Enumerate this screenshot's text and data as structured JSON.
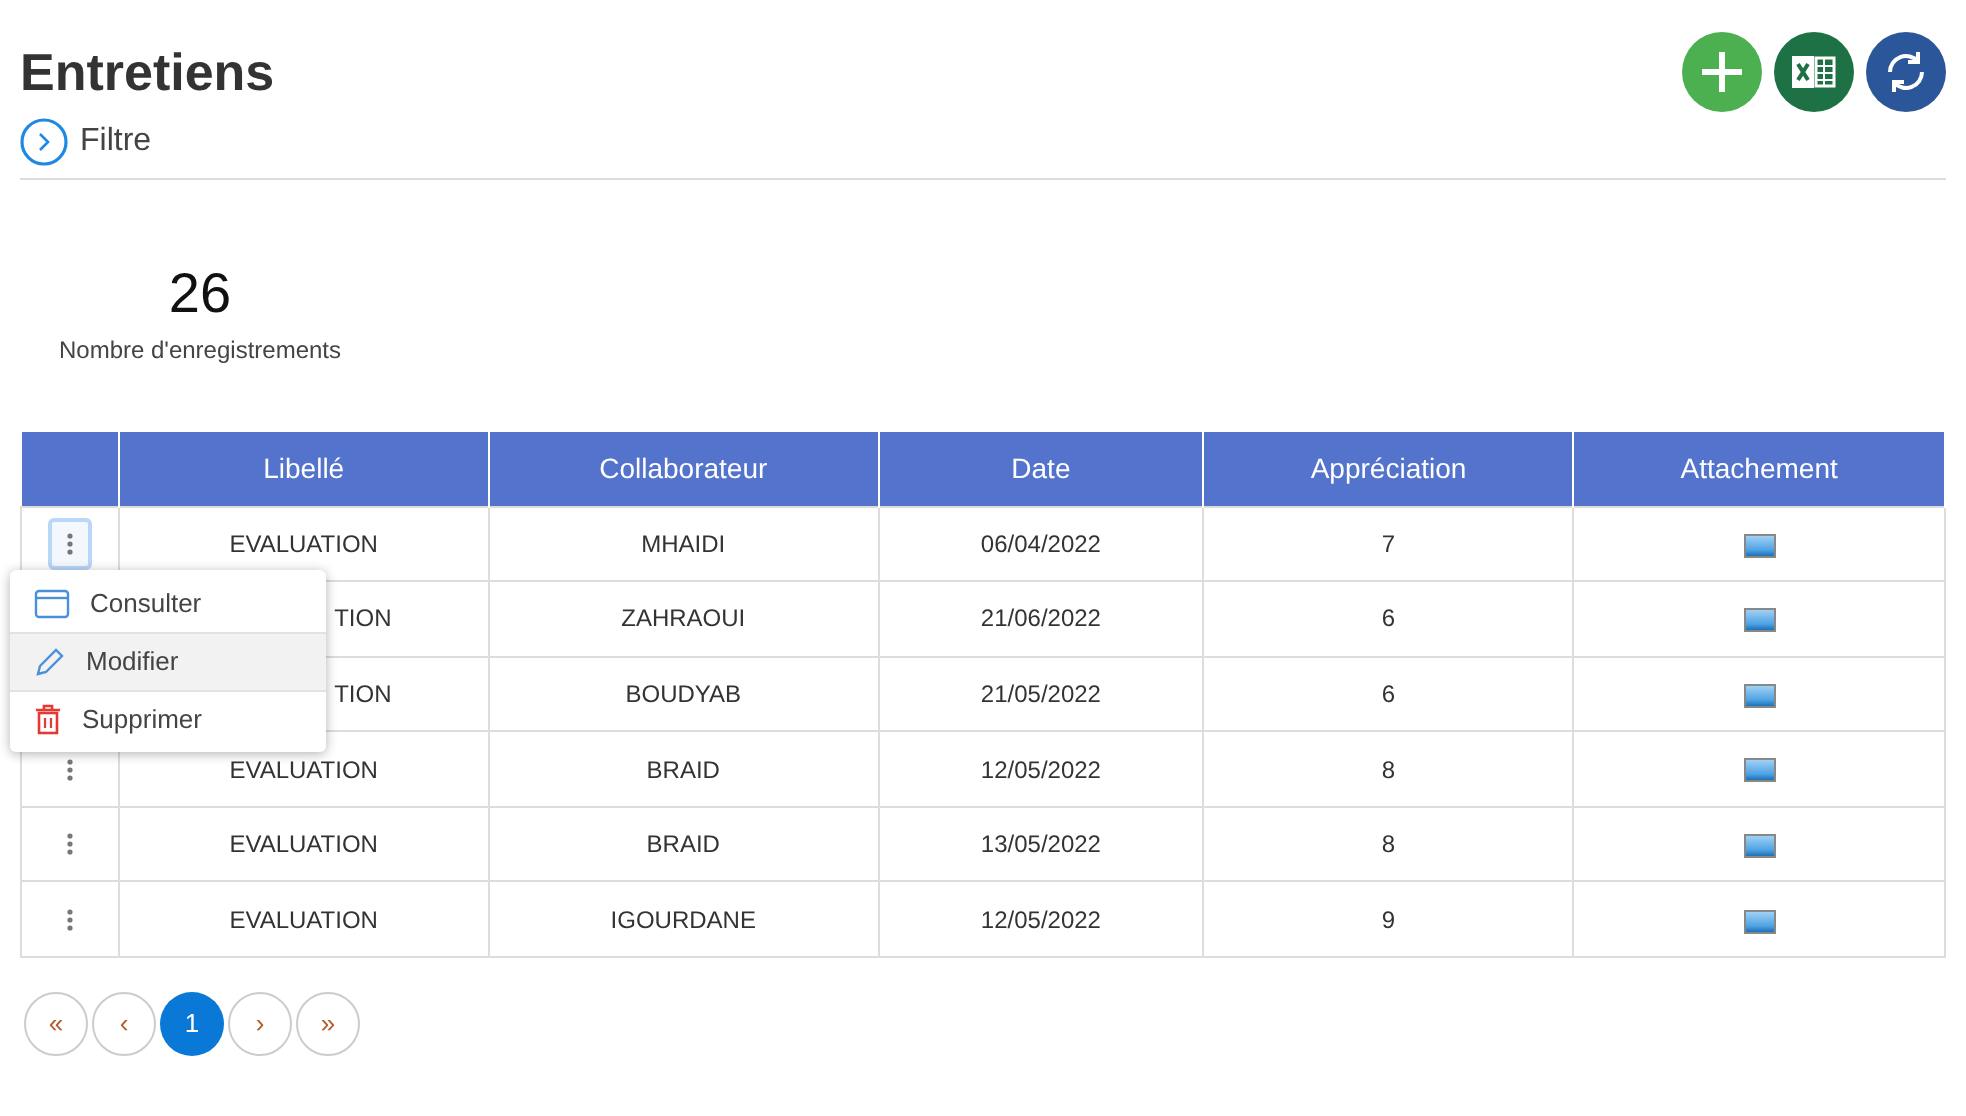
{
  "title": "Entretiens",
  "filter": {
    "label": "Filtre",
    "expanded": false
  },
  "stats": {
    "count": "26",
    "label": "Nombre d'enregistrements"
  },
  "table": {
    "columns": [
      "Libellé",
      "Collaborateur",
      "Date",
      "Appréciation",
      "Attachement"
    ],
    "rows": [
      {
        "menu_open": true,
        "clipped": false,
        "libelle": "EVALUATION",
        "collaborateur": "MHAIDI",
        "date": "06/04/2022",
        "appreciation": "7"
      },
      {
        "clipped": true,
        "libelle": "TION",
        "collaborateur": "ZAHRAOUI",
        "date": "21/06/2022",
        "appreciation": "6"
      },
      {
        "clipped": true,
        "libelle": "TION",
        "collaborateur": "BOUDYAB",
        "date": "21/05/2022",
        "appreciation": "6"
      },
      {
        "menu_open": false,
        "clipped": false,
        "libelle": "EVALUATION",
        "collaborateur": "BRAID",
        "date": "12/05/2022",
        "appreciation": "8"
      },
      {
        "menu_open": false,
        "clipped": false,
        "libelle": "EVALUATION",
        "collaborateur": "BRAID",
        "date": "13/05/2022",
        "appreciation": "8"
      },
      {
        "menu_open": false,
        "clipped": false,
        "libelle": "EVALUATION",
        "collaborateur": "IGOURDANE",
        "date": "12/05/2022",
        "appreciation": "9"
      }
    ]
  },
  "context_menu": [
    {
      "kind": "view",
      "label": "Consulter",
      "selected": false
    },
    {
      "kind": "edit",
      "label": "Modifier",
      "selected": true
    },
    {
      "kind": "delete",
      "label": "Supprimer",
      "selected": false
    }
  ],
  "pagination": [
    {
      "label": "«",
      "selected": false
    },
    {
      "label": "‹",
      "selected": false
    },
    {
      "label": "1",
      "selected": true
    },
    {
      "label": "›",
      "selected": false
    },
    {
      "label": "»",
      "selected": false
    }
  ]
}
